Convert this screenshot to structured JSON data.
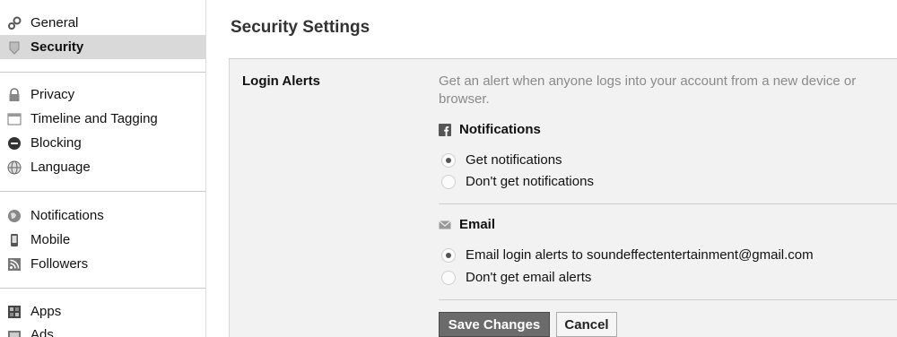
{
  "sidebar": {
    "items": [
      {
        "label": "General",
        "icon": "gears-icon"
      },
      {
        "label": "Security",
        "icon": "shield-icon",
        "selected": true
      },
      {
        "label": "Privacy",
        "icon": "lock-icon"
      },
      {
        "label": "Timeline and Tagging",
        "icon": "timeline-icon"
      },
      {
        "label": "Blocking",
        "icon": "block-icon"
      },
      {
        "label": "Language",
        "icon": "globe-icon"
      },
      {
        "label": "Notifications",
        "icon": "globe-notification-icon"
      },
      {
        "label": "Mobile",
        "icon": "phone-icon"
      },
      {
        "label": "Followers",
        "icon": "rss-icon"
      },
      {
        "label": "Apps",
        "icon": "apps-icon"
      },
      {
        "label": "Ads",
        "icon": "ads-icon"
      }
    ]
  },
  "main": {
    "title": "Security Settings",
    "section_label": "Login Alerts",
    "description": "Get an alert when anyone logs into your account from a new device or browser.",
    "notifications": {
      "heading": "Notifications",
      "icon": "facebook-icon",
      "options": [
        {
          "label": "Get notifications",
          "checked": true
        },
        {
          "label": "Don't get notifications",
          "checked": false
        }
      ]
    },
    "email": {
      "heading": "Email",
      "icon": "envelope-icon",
      "options": [
        {
          "label": "Email login alerts to soundeffectentertainment@gmail.com",
          "checked": true
        },
        {
          "label": "Don't get email alerts",
          "checked": false
        }
      ]
    },
    "buttons": {
      "save": "Save Changes",
      "cancel": "Cancel"
    }
  }
}
